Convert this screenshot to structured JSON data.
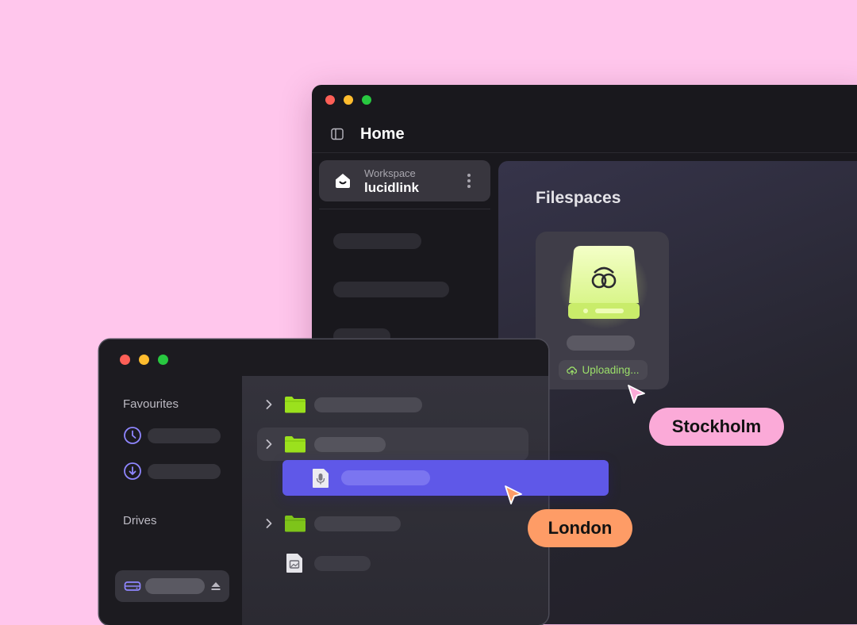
{
  "back_window": {
    "title": "Home",
    "workspace": {
      "label": "Workspace",
      "name": "lucidlink"
    },
    "filespaces": {
      "title": "Filespaces",
      "card": {
        "status": "Uploading..."
      }
    }
  },
  "front_window": {
    "sidebar": {
      "favourites_label": "Favourites",
      "drives_label": "Drives"
    }
  },
  "cursors": {
    "stockholm": {
      "name": "Stockholm",
      "color": "#fbaad8"
    },
    "london": {
      "name": "London",
      "color": "#fe9c66"
    }
  },
  "colors": {
    "background": "#ffc6ec",
    "drag_highlight": "#5f58e8",
    "folder": "#9be11d",
    "accent_icon": "#8f86ff",
    "upload_text": "#9ce06a"
  }
}
